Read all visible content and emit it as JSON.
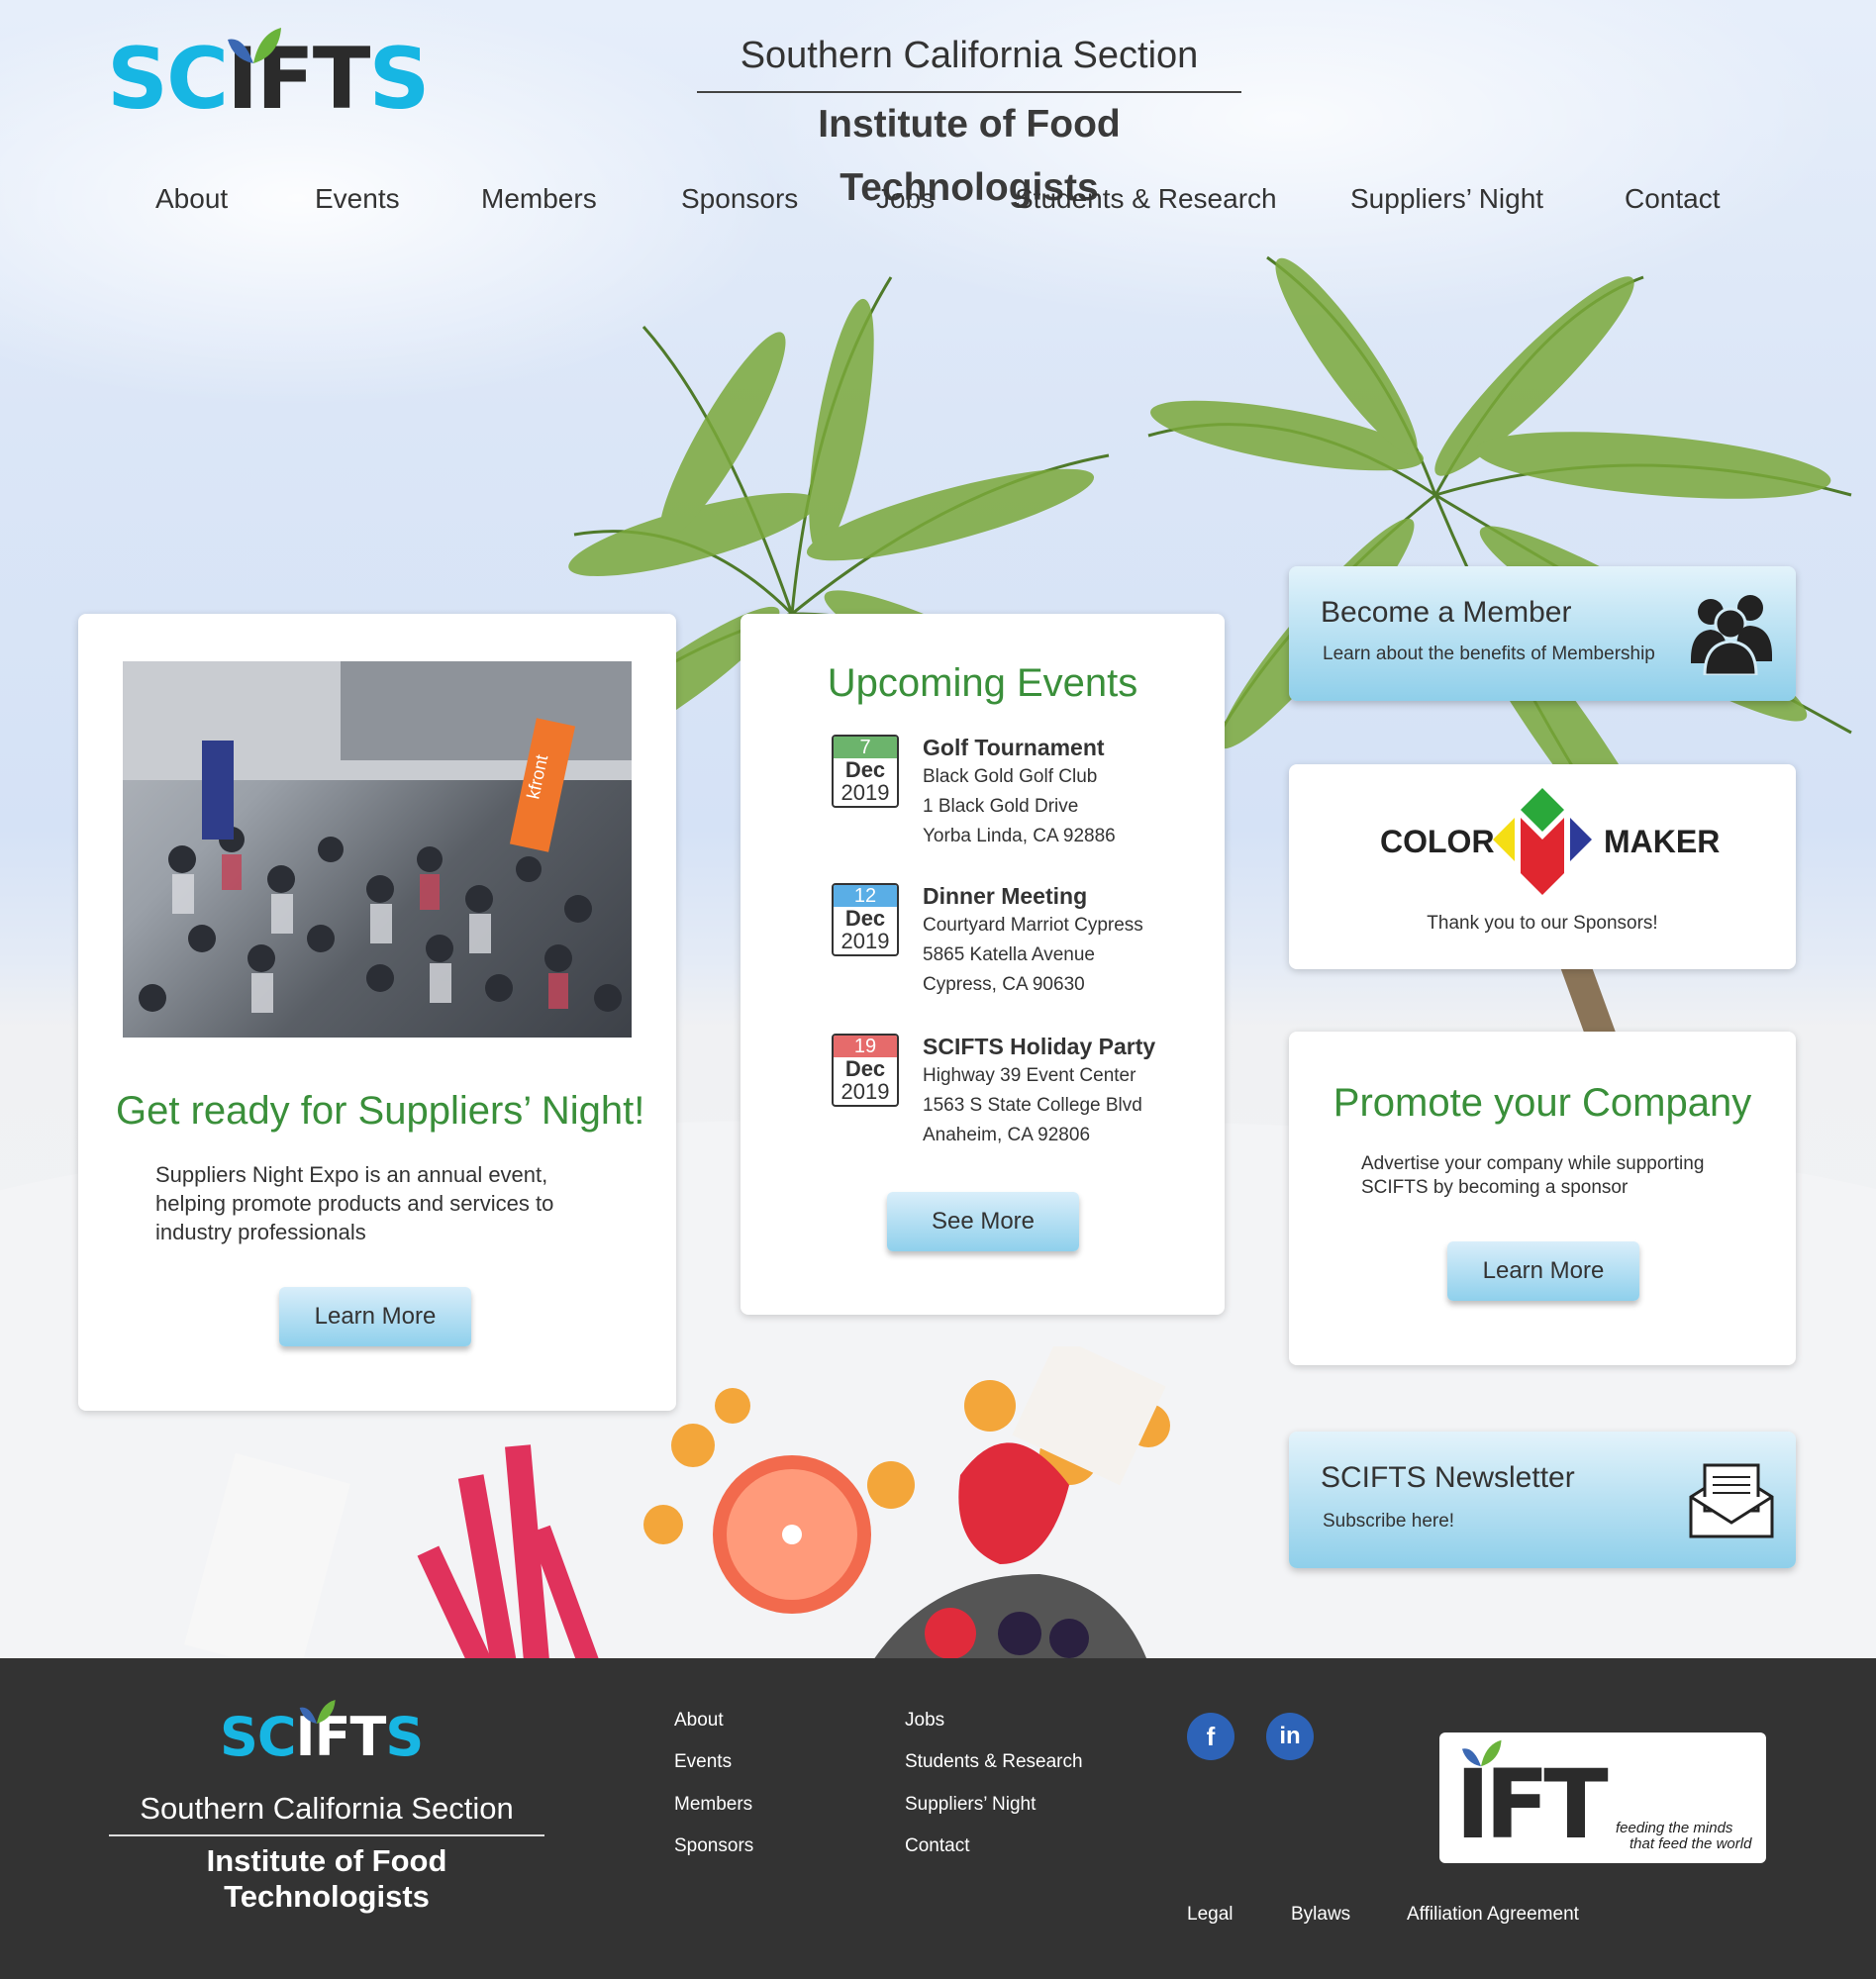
{
  "header": {
    "logo": {
      "part1": "SC",
      "part2": "IFT",
      "part3": "S"
    },
    "org_line1": "Southern California Section",
    "org_line2": "Institute of Food Technologists"
  },
  "nav": {
    "items": [
      "About",
      "Events",
      "Members",
      "Sponsors",
      "Jobs",
      "Students & Research",
      "Suppliers’ Night",
      "Contact"
    ]
  },
  "suppliers_card": {
    "title": "Get ready for Suppliers’ Night!",
    "body": "Suppliers Night Expo is an annual event, helping promote products and services to industry professionals",
    "button": "Learn More",
    "banner_text": "kfront"
  },
  "events_card": {
    "title": "Upcoming Events",
    "events": [
      {
        "day": "7",
        "month": "Dec",
        "year": "2019",
        "day_color": "#6cb46c",
        "name": "Golf Tournament",
        "line1": "Black Gold Golf Club",
        "line2": "1 Black Gold Drive",
        "line3": "Yorba Linda, CA 92886"
      },
      {
        "day": "12",
        "month": "Dec",
        "year": "2019",
        "day_color": "#5aaee6",
        "name": "Dinner Meeting",
        "line1": "Courtyard Marriot Cypress",
        "line2": "5865 Katella Avenue",
        "line3": "Cypress, CA 90630"
      },
      {
        "day": "19",
        "month": "Dec",
        "year": "2019",
        "day_color": "#e66b6b",
        "name": "SCIFTS Holiday Party",
        "line1": "Highway 39 Event Center",
        "line2": "1563 S State College Blvd",
        "line3": "Anaheim, CA 92806"
      }
    ],
    "button": "See More"
  },
  "member_card": {
    "title": "Become a Member",
    "subtitle": "Learn about the benefits of Membership"
  },
  "sponsor_card": {
    "logo_left": "COLOR",
    "logo_right": "MAKER",
    "caption": "Thank you to our Sponsors!"
  },
  "promote_card": {
    "title": "Promote your Company",
    "body": "Advertise your company while supporting SCIFTS by becoming a sponsor",
    "button": "Learn More"
  },
  "newsletter_card": {
    "title": "SCIFTS Newsletter",
    "subtitle": "Subscribe here!"
  },
  "footer": {
    "org_line1": "Southern California Section",
    "org_line2": "Institute of Food Technologists",
    "col1": [
      "About",
      "Events",
      "Members",
      "Sponsors"
    ],
    "col2": [
      "Jobs",
      "Students & Research",
      "Suppliers’ Night",
      "Contact"
    ],
    "social": {
      "facebook": "f",
      "linkedin": "in"
    },
    "ift_tagline1": "feeding the minds",
    "ift_tagline2": "that feed the world",
    "ift_logo": "IFT",
    "bottom_links": [
      "Legal",
      "Bylaws",
      "Affiliation Agreement"
    ]
  },
  "colors": {
    "brand_blue": "#17b6e3",
    "heading_green": "#3a8f3a",
    "footer_bg": "#333333",
    "button_blue": "#8fd0ec"
  }
}
